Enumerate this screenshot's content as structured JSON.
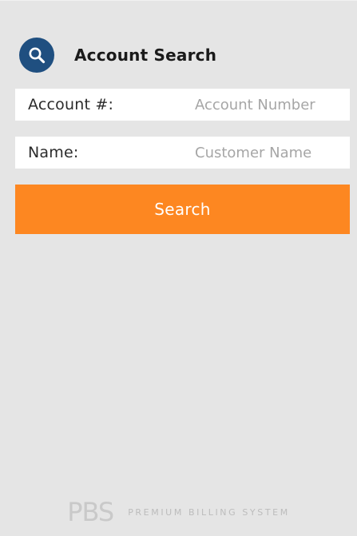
{
  "header": {
    "icon": "search-icon",
    "title": "Account Search"
  },
  "form": {
    "account": {
      "label": "Account #:",
      "placeholder": "Account Number",
      "value": ""
    },
    "name": {
      "label": "Name:",
      "placeholder": "Customer Name",
      "value": ""
    },
    "search_label": "Search"
  },
  "footer": {
    "logo": "PBS",
    "tagline": "PREMIUM BILLING SYSTEM"
  },
  "colors": {
    "background": "#e5e5e5",
    "accent": "#fd8721",
    "brand": "#1f4f80"
  }
}
